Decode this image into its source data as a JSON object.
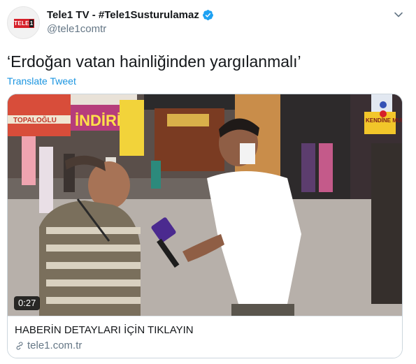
{
  "author": {
    "display_name": "Tele1 TV - #Tele1Susturulamaz",
    "handle": "@tele1comtr",
    "avatar_logo_text": "TELE",
    "avatar_logo_num": "1"
  },
  "tweet": {
    "text": "‘Erdoğan vatan hainliğinden yargılanmalı’",
    "translate_label": "Translate Tweet"
  },
  "card": {
    "video_duration": "0:27",
    "title": "HABERİN DETAYLARI İÇİN TIKLAYIN",
    "domain": "tele1.com.tr",
    "sign_indirim": "İNDİRİM",
    "sign_topaloglu": "TOPALOĞLU",
    "sign_kendine": "KENDİNE MUHAFIZ"
  },
  "colors": {
    "link": "#1b95e0",
    "verified": "#1da1f2",
    "muted": "#657786",
    "brand_red": "#d6202a"
  },
  "icons": {
    "verified": "verified-badge-icon",
    "caret": "chevron-down-icon",
    "link": "link-icon"
  }
}
